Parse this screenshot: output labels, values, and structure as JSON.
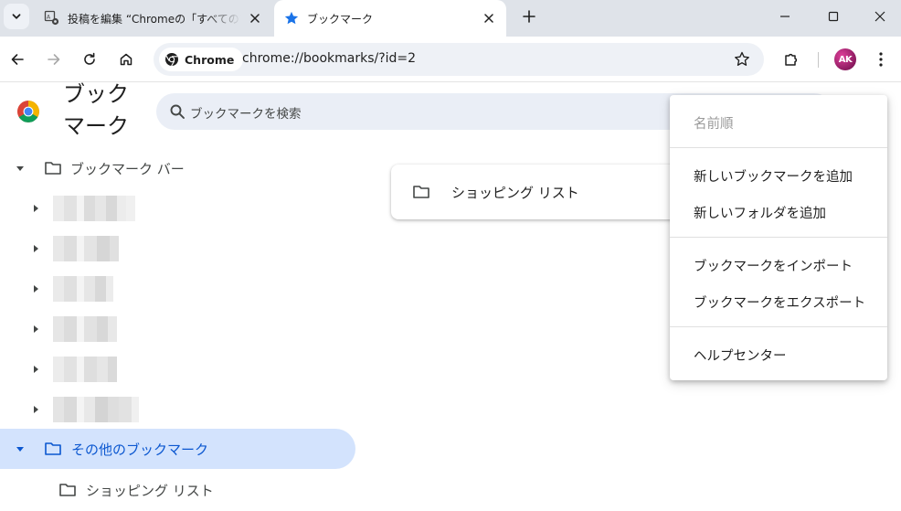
{
  "window": {
    "tabs": [
      {
        "title": "投稿を編集 “Chromeの「すべてのブックマーク」",
        "favicon": "wordpress-edit-icon",
        "active": false
      },
      {
        "title": "ブックマーク",
        "favicon": "star-icon",
        "active": true
      }
    ],
    "controls": [
      "minimize-icon",
      "maximize-icon",
      "close-icon"
    ]
  },
  "toolbar": {
    "chip_label": "Chrome",
    "url": "chrome://bookmarks/?id=2",
    "avatar_initials": "AK"
  },
  "page": {
    "title": "ブックマーク",
    "search_placeholder": "ブックマークを検索"
  },
  "tree": {
    "bookmarks_bar_label": "ブックマーク バー",
    "other_bookmarks_label": "その他のブックマーク",
    "shopping_list_label": "ショッピング リスト"
  },
  "main": {
    "items": [
      {
        "label": "ショッピング リスト",
        "icon": "folder-icon"
      }
    ]
  },
  "menu": {
    "sort_by_name": "名前順",
    "add_bookmark": "新しいブックマークを追加",
    "add_folder": "新しいフォルダを追加",
    "import": "ブックマークをインポート",
    "export": "ブックマークをエクスポート",
    "help": "ヘルプセンター"
  },
  "colors": {
    "accent": "#0b57d0",
    "selected_bg": "#d3e3fd",
    "tabstrip_bg": "#dfe3e9"
  }
}
